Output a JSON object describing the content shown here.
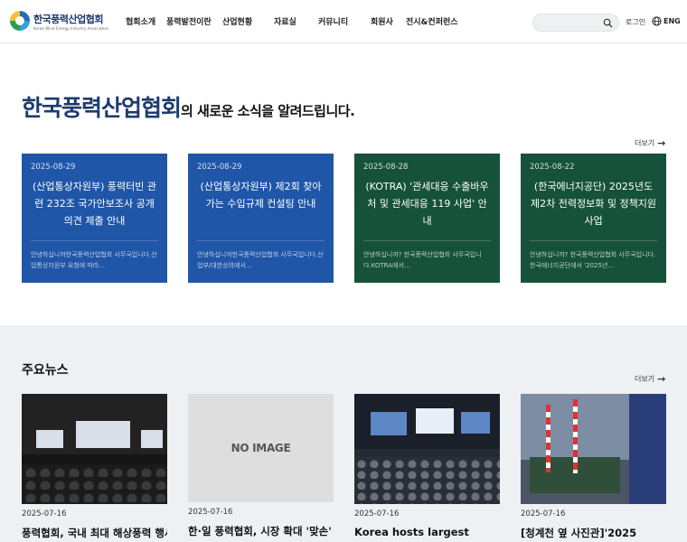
{
  "header": {
    "logo_name": "한국풍력산업협회",
    "logo_tagline": "Korea Wind Energy Industry Association",
    "nav": [
      "협회소개",
      "풍력발전이란",
      "산업현황",
      "자료실",
      "커뮤니티",
      "회원사",
      "전시&컨퍼런스"
    ],
    "search_placeholder": "",
    "login": "로그인",
    "lang": "ENG"
  },
  "notice": {
    "headline_strong": "한국풍력산업협회",
    "headline_rest": "의 새로운 소식을 알려드립니다.",
    "more": "더보기",
    "cards": [
      {
        "date": "2025-08-29",
        "title": "(산업통상자원부) 풍력터빈 관련 232조 국가안보조사 공개의견 제출 안내",
        "desc": "안녕하십니까한국풍력산업협회 사무국입니다.산업통상자원부 요청에 따라...",
        "theme": "blue"
      },
      {
        "date": "2025-08-29",
        "title": "(산업통상자원부) 제2회 찾아가는 수입규제 컨설팅 안내",
        "desc": "안녕하십니까한국풍력산업협회 사무국입니다.산업부/대한상의에서...",
        "theme": "blue"
      },
      {
        "date": "2025-08-28",
        "title": "(KOTRA) '관세대응 수출바우처 및 관세대응 119 사업' 안내",
        "desc": "안녕하십니까? 한국풍력산업협회 사무국입니다.KOTRA에서...",
        "theme": "green"
      },
      {
        "date": "2025-08-22",
        "title": "(한국에너지공단) 2025년도 제2차 전력정보화 및 정책지원사업",
        "desc": "안녕하십니까? 한국풍력산업협회 사무국입니다.한국에너지공단에서 '2025년...",
        "theme": "green"
      }
    ]
  },
  "news": {
    "title": "주요뉴스",
    "more": "더보기",
    "items": [
      {
        "date": "2025-07-16",
        "title": "풍력협회, 국내 최대 해상풍력 행사",
        "image": "photo"
      },
      {
        "date": "2025-07-16",
        "title": "한·일 풍력협회, 시장 확대 '맞손'",
        "image": "none",
        "no_image_label": "NO IMAGE"
      },
      {
        "date": "2025-07-16",
        "title": "Korea hosts largest",
        "image": "photo"
      },
      {
        "date": "2025-07-16",
        "title": "[청계천 옆 사진관]'2025",
        "image": "photo"
      }
    ]
  },
  "colors": {
    "brand": "#1d3b6e",
    "card_blue": "#1f56a8",
    "card_green": "#16523a"
  }
}
